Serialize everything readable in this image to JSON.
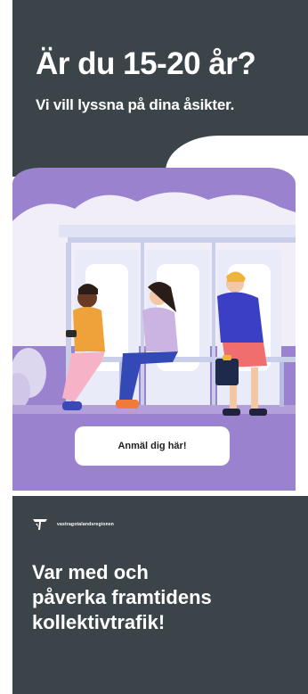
{
  "header": {
    "headline": "Är du 15-20 år?",
    "subline": "Vi vill lyssna på  dina åsikter."
  },
  "cta": {
    "label": "Anmäl dig här!"
  },
  "brand": {
    "name": "vastragotalandsregionen"
  },
  "slogan": {
    "lines": [
      "Var med och",
      "påverka framtidens",
      "kollektivtrafik!"
    ]
  },
  "colors": {
    "dark_panel": "#3b4448",
    "purple_panel": "#9b82cf",
    "button_bg": "#ffffff"
  },
  "illustration": {
    "subject": "three young people waiting at a bus stop shelter",
    "icons": [
      "person-with-phone-icon",
      "person-sitting-icon",
      "person-standing-with-bag-icon",
      "bus-shelter-icon",
      "bench-icon",
      "plant-icon"
    ]
  }
}
